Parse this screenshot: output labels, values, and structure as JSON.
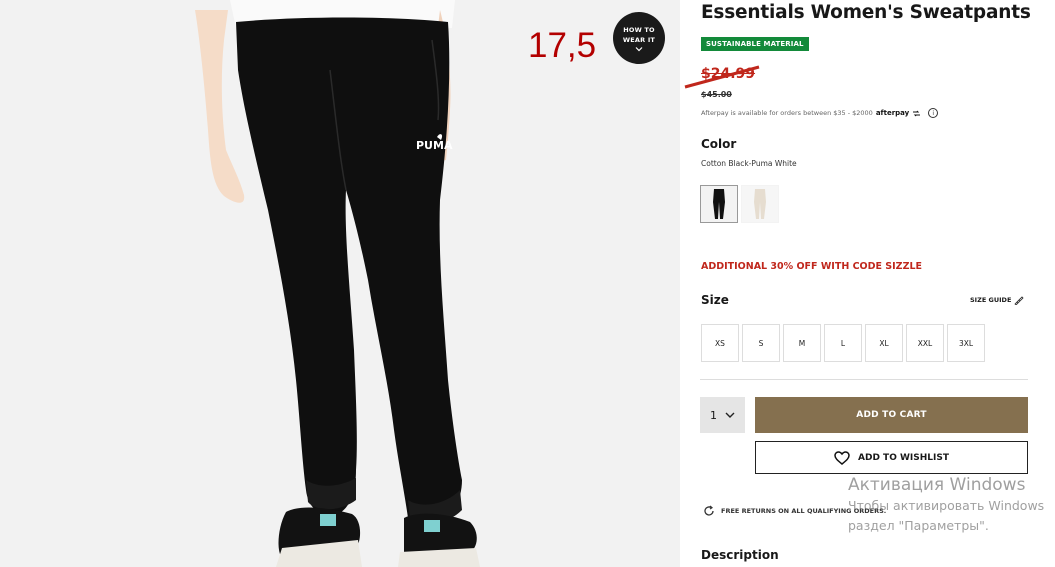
{
  "product": {
    "title": "Essentials Women's Sweatpants",
    "badge": "SUSTAINABLE MATERIAL",
    "price_sale": "$24.99",
    "price_original": "$45.00",
    "afterpay_text": "Afterpay is available for orders between $35 - $2000",
    "afterpay_logo": "afterpay",
    "color_heading": "Color",
    "color_value": "Cotton Black-Puma White",
    "promo": "ADDITIONAL 30% OFF WITH CODE SIZZLE",
    "size_heading": "Size",
    "size_guide": "SIZE GUIDE",
    "sizes": [
      "XS",
      "S",
      "M",
      "L",
      "XL",
      "XXL",
      "3XL"
    ],
    "quantity": "1",
    "add_to_cart": "ADD TO CART",
    "add_to_wishlist": "ADD TO WISHLIST",
    "returns_text": "FREE RETURNS ON ALL QUALIFYING ORDERS.",
    "description_heading": "Description"
  },
  "gallery": {
    "how_to_wear_line1": "HOW TO",
    "how_to_wear_line2": "WEAR IT",
    "annotation": "17,5",
    "logo_text": "PUMA"
  },
  "overlay": {
    "windows_line1": "Активация Windows",
    "windows_line2": "Чтобы активировать Windows",
    "windows_line3": "раздел \"Параметры\"."
  },
  "colors": {
    "accent": "#85704f",
    "sale": "#c0271c",
    "badge": "#138a3a"
  }
}
